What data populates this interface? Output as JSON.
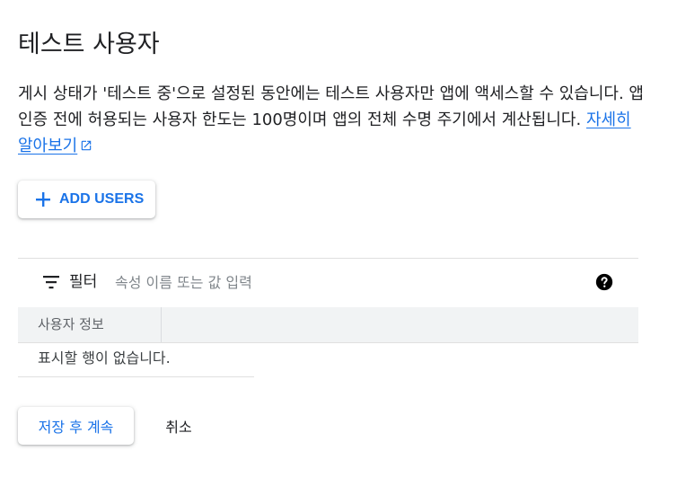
{
  "page": {
    "title": "테스트 사용자",
    "description_text": "게시 상태가 '테스트 중'으로 설정된 동안에는 테스트 사용자만 앱에 액세스할 수 있습니다. 앱 인증 전에 허용되는 사용자 한도는 100명이며 앱의 전체 수명 주기에서 계산됩니다. ",
    "learn_more_link": "자세히 알아보기"
  },
  "add_users_button": {
    "label": "ADD USERS",
    "icon": "plus-icon"
  },
  "filter": {
    "label": "필터",
    "placeholder": "속성 이름 또는 값 입력",
    "icon": "filter-icon",
    "help_icon": "help-circle-icon"
  },
  "table": {
    "columns": [
      "사용자 정보"
    ],
    "empty_message": "표시할 행이 없습니다."
  },
  "actions": {
    "save_continue": "저장 후 계속",
    "cancel": "취소"
  },
  "colors": {
    "accent": "#1a73e8",
    "text": "#202124",
    "muted": "#5f6368",
    "header_bg": "#f1f3f4",
    "divider": "#e0e0e0"
  }
}
